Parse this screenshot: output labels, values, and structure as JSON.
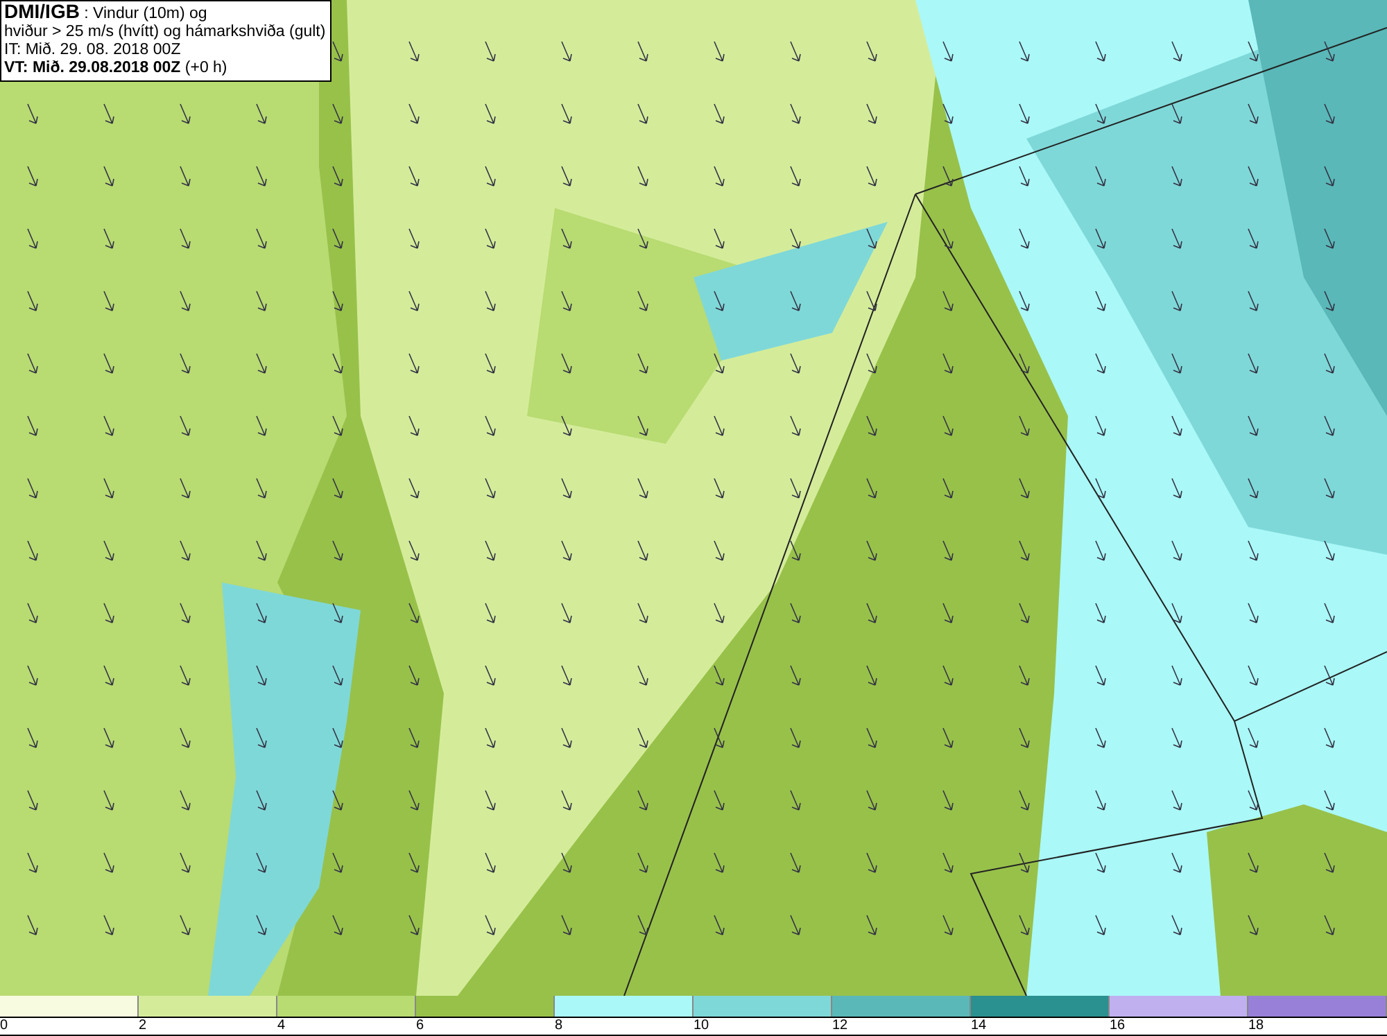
{
  "title_box": {
    "lines": [
      "**DMI/IGB** : Vindur (10m) og",
      "hviður > 25 m/s (hvítt) og hámarkshviða (gult)",
      "IT: Mið. 29. 08. 2018 00Z",
      "**VT: Mið. 29.08.2018 00Z** (+0 h)"
    ]
  },
  "legend": [
    {
      "label": "0",
      "color": "#f7fbe0"
    },
    {
      "label": "2",
      "color": "#d4ec9a"
    },
    {
      "label": "4",
      "color": "#b8db72"
    },
    {
      "label": "6",
      "color": "#98c14a"
    },
    {
      "label": "8",
      "color": "#aaf8f8"
    },
    {
      "label": "10",
      "color": "#7fd8d8"
    },
    {
      "label": "12",
      "color": "#5ab8b8"
    },
    {
      "label": "14",
      "color": "#2a9090"
    },
    {
      "label": "16",
      "color": "#c0b0f0"
    },
    {
      "label": "18",
      "color": "#9880d8"
    }
  ]
}
